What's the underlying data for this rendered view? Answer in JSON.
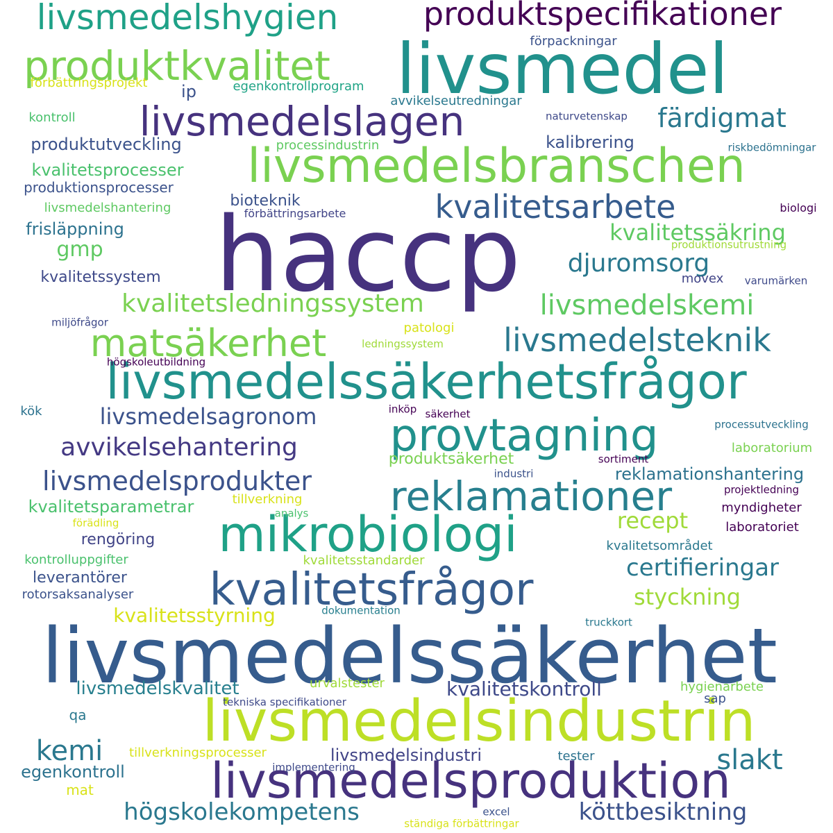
{
  "colors": {
    "background": "#ffffff",
    "palette": [
      "#440154",
      "#46327e",
      "#365c8d",
      "#277f8e",
      "#1fa187",
      "#4ac16d",
      "#a0da39",
      "#fde725"
    ]
  },
  "words": [
    {
      "text": "haccp",
      "color": "#46327e"
    },
    {
      "text": "livsmedelssäkerhet",
      "color": "#365c8d"
    },
    {
      "text": "livsmedel",
      "color": "#21918c"
    },
    {
      "text": "livsmedelsindustrin",
      "color": "#bddf26"
    },
    {
      "text": "livsmedelssäkerhetsfrågor",
      "color": "#21918c"
    },
    {
      "text": "livsmedelsproduktion",
      "color": "#46327e"
    },
    {
      "text": "mikrobiologi",
      "color": "#1fa187"
    },
    {
      "text": "livsmedelsbranschen",
      "color": "#7ad151"
    },
    {
      "text": "provtagning",
      "color": "#21918c"
    },
    {
      "text": "kvalitetsfrågor",
      "color": "#365c8d"
    },
    {
      "text": "reklamationer",
      "color": "#277f8e"
    },
    {
      "text": "produktkvalitet",
      "color": "#7ad151"
    },
    {
      "text": "livsmedelslagen",
      "color": "#46327e"
    },
    {
      "text": "matsäkerhet",
      "color": "#7ad151"
    },
    {
      "text": "livsmedelshygien",
      "color": "#1fa187"
    },
    {
      "text": "produktspecifikationer",
      "color": "#440154"
    },
    {
      "text": "kvalitetsarbete",
      "color": "#365c8d"
    },
    {
      "text": "livsmedelsteknik",
      "color": "#2a788e"
    },
    {
      "text": "livsmedelskemi",
      "color": "#5ec962"
    },
    {
      "text": "livsmedelsprodukter",
      "color": "#3b528b"
    },
    {
      "text": "kvalitetsledningssystem",
      "color": "#7ad151"
    },
    {
      "text": "avvikelsehantering",
      "color": "#443983"
    },
    {
      "text": "färdigmat",
      "color": "#2a788e"
    },
    {
      "text": "djuromsorg",
      "color": "#2a788e"
    },
    {
      "text": "certifieringar",
      "color": "#2a788e"
    },
    {
      "text": "högskolekompetens",
      "color": "#2a788e"
    },
    {
      "text": "köttbesiktning",
      "color": "#3b528b"
    },
    {
      "text": "livsmedelsagronom",
      "color": "#3b528b"
    },
    {
      "text": "styckning",
      "color": "#a0da39"
    },
    {
      "text": "kvalitetssäkring",
      "color": "#5ec962"
    },
    {
      "text": "slakt",
      "color": "#2a788e"
    },
    {
      "text": "recept",
      "color": "#a0da39"
    },
    {
      "text": "kvalitetskontroll",
      "color": "#3e4989"
    },
    {
      "text": "kemi",
      "color": "#2a788e"
    },
    {
      "text": "kvalitetsstyrning",
      "color": "#d8e219"
    },
    {
      "text": "livsmedelskvalitet",
      "color": "#277f8e"
    },
    {
      "text": "reklamationshantering",
      "color": "#2c728e"
    },
    {
      "text": "gmp",
      "color": "#5ec962"
    },
    {
      "text": "kvalitetsprocesser",
      "color": "#4ac16d"
    },
    {
      "text": "kvalitetsparametrar",
      "color": "#4ac16d"
    },
    {
      "text": "produktutveckling",
      "color": "#3b528b"
    },
    {
      "text": "frisläppning",
      "color": "#2c728e"
    },
    {
      "text": "egenkontroll",
      "color": "#2c728e"
    },
    {
      "text": "livsmedelsindustri",
      "color": "#414487"
    },
    {
      "text": "produktsäkerhet",
      "color": "#7ad151"
    },
    {
      "text": "kalibrering",
      "color": "#3b528b"
    },
    {
      "text": "leverantörer",
      "color": "#3b528b"
    },
    {
      "text": "kvalitetssystem",
      "color": "#3e4989"
    },
    {
      "text": "rengöring",
      "color": "#414487"
    },
    {
      "text": "bioteknik",
      "color": "#3b528b"
    },
    {
      "text": "ip",
      "color": "#3b528b"
    },
    {
      "text": "produktionsprocesser",
      "color": "#3b528b"
    },
    {
      "text": "livsmedelshantering",
      "color": "#5ec962"
    },
    {
      "text": "kontroll",
      "color": "#4ac16d"
    },
    {
      "text": "egenkontrollprogram",
      "color": "#20a486"
    },
    {
      "text": "förbättringsprojekt",
      "color": "#d8e219"
    },
    {
      "text": "avvikelseutredningar",
      "color": "#2a788e"
    },
    {
      "text": "förpackningar",
      "color": "#3b528b"
    },
    {
      "text": "processindustrin",
      "color": "#5ec962"
    },
    {
      "text": "naturvetenskap",
      "color": "#3e4989"
    },
    {
      "text": "riskbedömningar",
      "color": "#2c728e"
    },
    {
      "text": "förbättringsarbete",
      "color": "#414487"
    },
    {
      "text": "biologi",
      "color": "#440154"
    },
    {
      "text": "produktionsutrustning",
      "color": "#a0da39"
    },
    {
      "text": "movex",
      "color": "#414487"
    },
    {
      "text": "varumärken",
      "color": "#3e4989"
    },
    {
      "text": "miljöfrågor",
      "color": "#3e4989"
    },
    {
      "text": "patologi",
      "color": "#d8e219"
    },
    {
      "text": "ledningssystem",
      "color": "#a0da39"
    },
    {
      "text": "högskoleutbildning",
      "color": "#440154"
    },
    {
      "text": "kök",
      "color": "#2c728e"
    },
    {
      "text": "inköp",
      "color": "#440154"
    },
    {
      "text": "säkerhet",
      "color": "#440154"
    },
    {
      "text": "processutveckling",
      "color": "#2c728e"
    },
    {
      "text": "laboratorium",
      "color": "#7ad151"
    },
    {
      "text": "sortiment",
      "color": "#440154"
    },
    {
      "text": "industri",
      "color": "#3b528b"
    },
    {
      "text": "projektledning",
      "color": "#440154"
    },
    {
      "text": "myndigheter",
      "color": "#440154"
    },
    {
      "text": "laboratoriet",
      "color": "#440154"
    },
    {
      "text": "tillverkning",
      "color": "#d8e219"
    },
    {
      "text": "analys",
      "color": "#4ac16d"
    },
    {
      "text": "förädling",
      "color": "#d8e219"
    },
    {
      "text": "kvalitetsområdet",
      "color": "#2a788e"
    },
    {
      "text": "kontrolluppgifter",
      "color": "#4ac16d"
    },
    {
      "text": "kvalitetsstandarder",
      "color": "#a0da39"
    },
    {
      "text": "rotorsaksanalyser",
      "color": "#3b528b"
    },
    {
      "text": "dokumentation",
      "color": "#277f8e"
    },
    {
      "text": "truckkort",
      "color": "#2a788e"
    },
    {
      "text": "urvalstester",
      "color": "#a0da39"
    },
    {
      "text": "hygienarbete",
      "color": "#7ad151"
    },
    {
      "text": "sap",
      "color": "#3b528b"
    },
    {
      "text": "tekniska specifikationer",
      "color": "#3e4989"
    },
    {
      "text": "qa",
      "color": "#2a788e"
    },
    {
      "text": "tillverkningsprocesser",
      "color": "#d8e219"
    },
    {
      "text": "tester",
      "color": "#2c728e"
    },
    {
      "text": "implementering",
      "color": "#3e4989"
    },
    {
      "text": "mat",
      "color": "#d8e219"
    },
    {
      "text": "excel",
      "color": "#3b528b"
    },
    {
      "text": "ständiga förbättringar",
      "color": "#d8e219"
    }
  ]
}
